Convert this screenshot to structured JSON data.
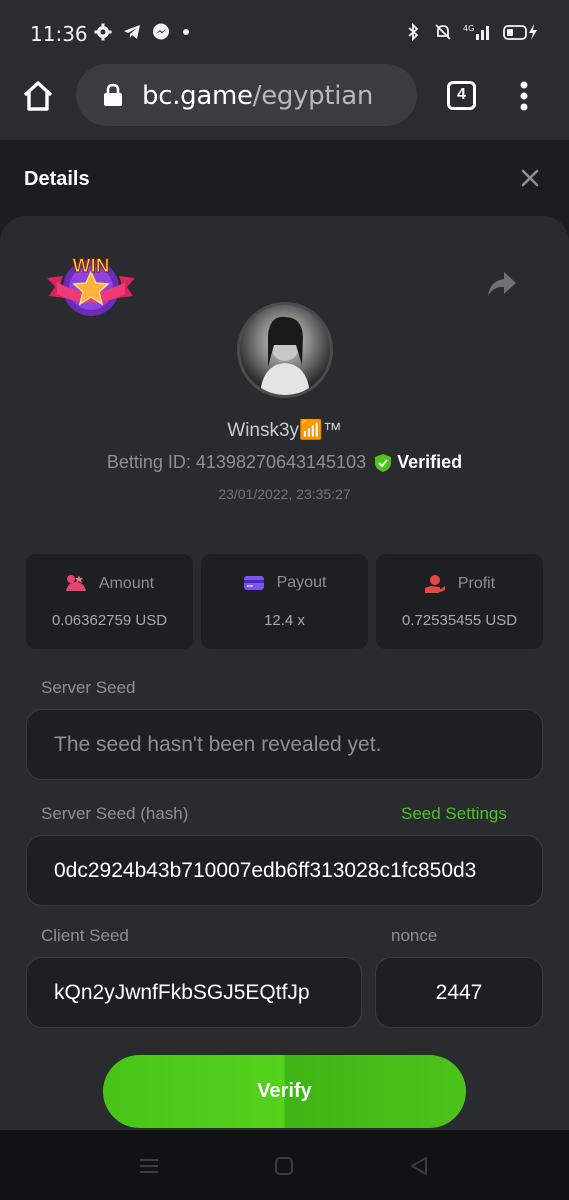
{
  "status": {
    "time": "11:36",
    "network": "4G"
  },
  "browser": {
    "domain": "bc.game",
    "path": "/egyptian",
    "tab_count": "4"
  },
  "details": {
    "title": "Details",
    "win_badge": "WIN",
    "username": "Winsk3y📶™",
    "betting_id": "Betting ID: 41398270643145103",
    "verified_label": "Verified",
    "timestamp": "23/01/2022, 23:35:27"
  },
  "stats": [
    {
      "label": "Amount",
      "value": "0.06362759 USD",
      "icon": "amount-icon",
      "color": "#e8426f"
    },
    {
      "label": "Payout",
      "value": "12.4 x",
      "icon": "payout-card-icon",
      "color": "#7b52f5"
    },
    {
      "label": "Profit",
      "value": "0.72535455 USD",
      "icon": "profit-hand-icon",
      "color": "#e84545"
    }
  ],
  "server_seed": {
    "label": "Server Seed",
    "placeholder": "The seed hasn't been revealed yet."
  },
  "server_seed_hash": {
    "label": "Server Seed (hash)",
    "value": "0dc2924b43b710007edb6ff313028c1fc850d3",
    "settings_link": "Seed Settings"
  },
  "client_seed": {
    "label": "Client Seed",
    "value": "kQn2yJwnfFkbSGJ5EQtfJp"
  },
  "nonce": {
    "label": "nonce",
    "value": "2447"
  },
  "verify_label": "Verify",
  "colors": {
    "accent_green": "#4cc41d",
    "background": "#1c1d20",
    "card": "#2a2b2f"
  }
}
